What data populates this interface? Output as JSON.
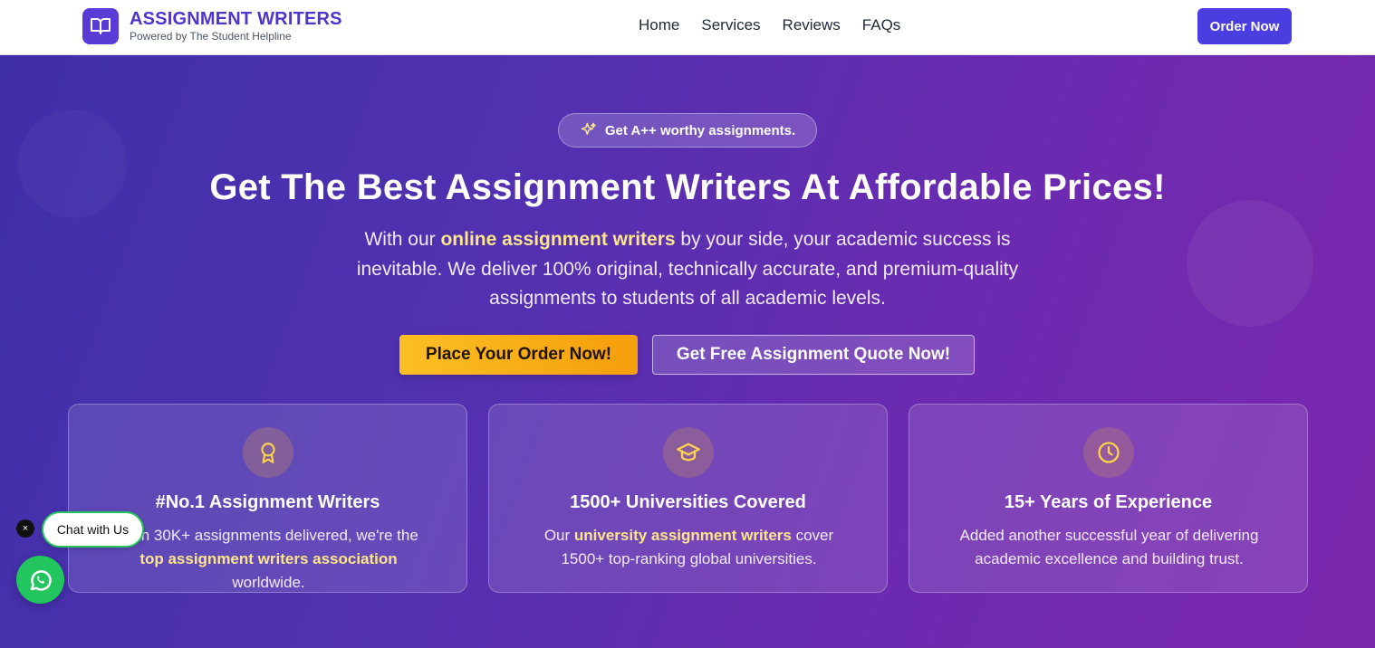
{
  "header": {
    "brand_name": "ASSIGNMENT WRITERS",
    "brand_sub": "Powered by The Student Helpline",
    "nav": [
      "Home",
      "Services",
      "Reviews",
      "FAQs"
    ],
    "order_label": "Order Now",
    "logo_icon": "open-book-icon",
    "accent": "#4a3ee0"
  },
  "hero": {
    "pill": "Get A++ worthy assignments.",
    "pill_icon": "sparkles-icon",
    "headline": "Get The Best Assignment Writers At Affordable Prices!",
    "lead_pre": "With our ",
    "lead_hl": "online assignment writers",
    "lead_post": " by your side, your academic success is inevitable. We deliver 100% original, technically accurate, and premium-quality assignments to students of all academic levels.",
    "cta_primary": "Place Your Order Now!",
    "cta_secondary": "Get Free Assignment Quote Now!",
    "highlight_color": "#fde68a"
  },
  "cards": [
    {
      "icon": "award-ribbon-icon",
      "title": "#No.1 Assignment Writers",
      "text_pre": "With 30K+ assignments delivered, we're the ",
      "text_hl": "top assignment writers association",
      "text_post": " worldwide."
    },
    {
      "icon": "graduation-cap-icon",
      "title": "1500+ Universities Covered",
      "text_pre": "Our ",
      "text_hl": "university assignment writers",
      "text_post": " cover 1500+ top-ranking global universities."
    },
    {
      "icon": "clock-icon",
      "title": "15+ Years of Experience",
      "text_pre": "Added another successful year of delivering academic excellence and building trust.",
      "text_hl": "",
      "text_post": ""
    }
  ],
  "chat": {
    "label": "Chat with Us",
    "close_glyph": "×",
    "whatsapp_icon": "whatsapp-icon"
  }
}
